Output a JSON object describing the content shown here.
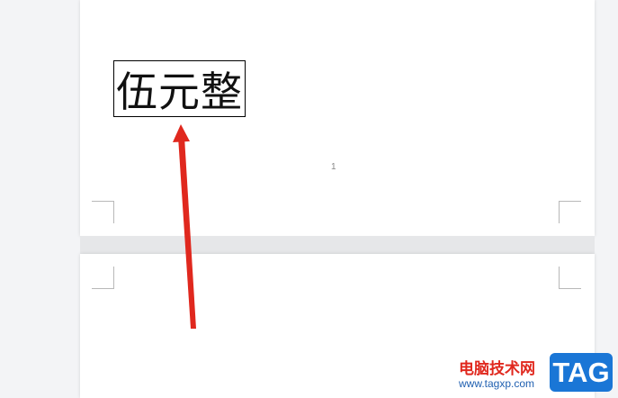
{
  "document": {
    "textbox_text": "伍元整",
    "page_number": "1"
  },
  "watermark": {
    "site_name": "电脑技术网",
    "url": "www.tagxp.com",
    "tag": "TAG"
  },
  "colors": {
    "arrow": "#e0281e",
    "tag_bg": "#1a76d6",
    "background": "#f3f4f6"
  }
}
